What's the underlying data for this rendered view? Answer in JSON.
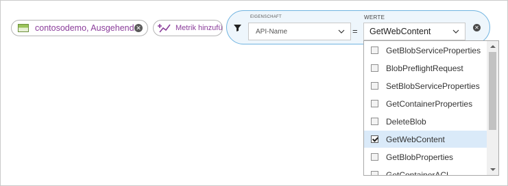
{
  "metric_pill": {
    "label": "contosodemo, Ausgehend, Summe",
    "icon": "storage-metric-icon",
    "close_glyph": "✕"
  },
  "add_metric": {
    "label": "Metrik hinzufügen",
    "icon": "add-metric-icon"
  },
  "filter": {
    "icon": "filter-icon",
    "property_label": "EIGENSCHAFT",
    "property_value": "API-Name",
    "operator": "=",
    "values_label": "WERTE",
    "values_value": "GetWebContent",
    "close_glyph": "✕"
  },
  "dropdown": {
    "options": [
      {
        "label": "GetBlobServiceProperties",
        "checked": false
      },
      {
        "label": "BlobPreflightRequest",
        "checked": false
      },
      {
        "label": "SetBlobServiceProperties",
        "checked": false
      },
      {
        "label": "GetContainerProperties",
        "checked": false
      },
      {
        "label": "DeleteBlob",
        "checked": false
      },
      {
        "label": "GetWebContent",
        "checked": true
      },
      {
        "label": "GetBlobProperties",
        "checked": false
      },
      {
        "label": "GetContainerACL",
        "checked": false
      }
    ]
  },
  "colors": {
    "accent_purple": "#8a3c9a",
    "bubble_border": "#6fb3e0",
    "selected_row": "#daeaf9"
  }
}
